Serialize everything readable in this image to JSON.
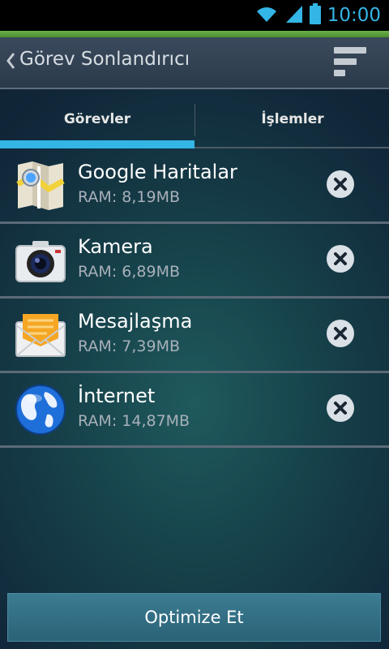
{
  "status_bar": {
    "time": "10:00"
  },
  "action_bar": {
    "title": "Görev Sonlandırıcı"
  },
  "tabs": [
    {
      "label": "Görevler",
      "selected": true
    },
    {
      "label": "İşlemler",
      "selected": false
    }
  ],
  "tasks": [
    {
      "name": "Google Haritalar",
      "ram": "RAM: 8,19MB",
      "icon": "maps-icon"
    },
    {
      "name": "Kamera",
      "ram": "RAM: 6,89MB",
      "icon": "camera-icon"
    },
    {
      "name": "Mesajlaşma",
      "ram": "RAM: 7,39MB",
      "icon": "messaging-icon"
    },
    {
      "name": "İnternet",
      "ram": "RAM: 14,87MB",
      "icon": "globe-icon"
    }
  ],
  "bottom": {
    "button_label": "Optimize Et"
  },
  "colors": {
    "accent": "#33b5e5",
    "green_bar": "#6ab04c"
  }
}
